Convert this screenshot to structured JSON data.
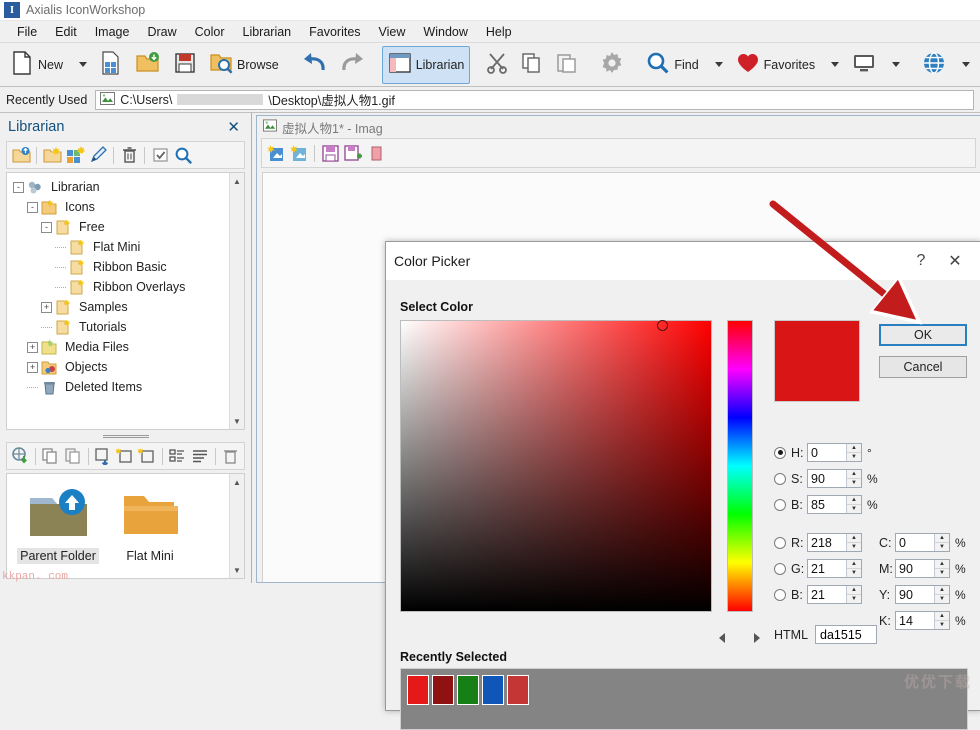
{
  "window": {
    "app_icon_glyph": "I",
    "title": "Axialis IconWorkshop"
  },
  "menubar": {
    "items": [
      "File",
      "Edit",
      "Image",
      "Draw",
      "Color",
      "Librarian",
      "Favorites",
      "View",
      "Window",
      "Help"
    ]
  },
  "toolbar": {
    "new_label": "New",
    "browse_label": "Browse",
    "librarian_label": "Librarian",
    "find_label": "Find",
    "favorites_label": "Favorites",
    "icons": {
      "new": "new-document-icon",
      "new_from_image": "new-from-image-icon",
      "open": "open-folder-icon",
      "save": "save-floppy-icon",
      "browse": "browse-folder-search-icon",
      "undo": "undo-arrow-icon",
      "redo": "redo-arrow-icon",
      "librarian": "librarian-window-icon",
      "cut": "scissors-icon",
      "copy": "copy-icon",
      "paste": "paste-icon",
      "settings": "gear-icon",
      "find": "magnifier-icon",
      "favorites": "heart-icon",
      "display": "monitor-icon",
      "web": "globe-icon",
      "help": "question-help-icon",
      "web2": "globe-green-icon"
    }
  },
  "recently_used": {
    "label": "Recently Used",
    "path_prefix": "C:\\Users\\",
    "path_suffix": "\\Desktop\\虚拟人物1.gif",
    "file_icon": "image-file-icon"
  },
  "librarian_panel": {
    "title": "Librarian",
    "close_icon": "close-icon",
    "toolbar_icons": [
      "new-library-folder-icon",
      "open-library-folder-icon",
      "new-library-icon",
      "rename-pencil-icon",
      "delete-trash-icon",
      "select-checkbox-icon",
      "search-magnifier-icon"
    ],
    "tree": [
      {
        "label": "Librarian",
        "depth": 0,
        "expander": "-",
        "icon": "librarian-root-icon"
      },
      {
        "label": "Icons",
        "depth": 1,
        "expander": "-",
        "icon": "folder-icons-icon"
      },
      {
        "label": "Free",
        "depth": 2,
        "expander": "-",
        "icon": "folder-page-icon"
      },
      {
        "label": "Flat Mini",
        "depth": 3,
        "expander": "",
        "icon": "folder-page-icon"
      },
      {
        "label": "Ribbon Basic",
        "depth": 3,
        "expander": "",
        "icon": "folder-page-icon"
      },
      {
        "label": "Ribbon Overlays",
        "depth": 3,
        "expander": "",
        "icon": "folder-page-icon"
      },
      {
        "label": "Samples",
        "depth": 2,
        "expander": "+",
        "icon": "folder-page-icon"
      },
      {
        "label": "Tutorials",
        "depth": 2,
        "expander": "",
        "icon": "folder-page-icon"
      },
      {
        "label": "Media Files",
        "depth": 1,
        "expander": "+",
        "icon": "folder-media-icon"
      },
      {
        "label": "Objects",
        "depth": 1,
        "expander": "+",
        "icon": "folder-objects-icon"
      },
      {
        "label": "Deleted Items",
        "depth": 1,
        "expander": "",
        "icon": "recycle-bin-icon"
      }
    ],
    "browse_toolbar_icons": [
      "globe-download-icon",
      "copy-icon",
      "paste-icon",
      "import-image-icon",
      "new-item-icon",
      "new-item-alt-icon",
      "sort-icon",
      "list-view-icon",
      "delete-trash-icon"
    ],
    "folders": [
      {
        "label": "Parent Folder",
        "icon": "parent-folder-up-icon",
        "selected": true
      },
      {
        "label": "Flat Mini",
        "icon": "folder-open-icon",
        "selected": false
      }
    ],
    "footer_watermark": "kkpan. com"
  },
  "document_window": {
    "title": "虚拟人物1* - Imag",
    "title_icon": "image-file-icon",
    "toolbar_icons": [
      "new-layer-icon",
      "new-layer-alt-icon",
      "save-icon",
      "save-as-icon",
      "delete-icon"
    ]
  },
  "color_picker": {
    "title": "Color Picker",
    "help_glyph": "?",
    "close_glyph": "✕",
    "select_color_label": "Select Color",
    "recently_selected_label": "Recently Selected",
    "ok_label": "OK",
    "cancel_label": "Cancel",
    "preview_color": "#da1515",
    "sv_cursor": {
      "x_pct": 87,
      "y_pct": 0
    },
    "fields": {
      "h": {
        "label": "H:",
        "value": "0",
        "unit": "°",
        "selected": true
      },
      "s": {
        "label": "S:",
        "value": "90",
        "unit": "%",
        "selected": false
      },
      "b": {
        "label": "B:",
        "value": "85",
        "unit": "%",
        "selected": false
      },
      "r": {
        "label": "R:",
        "value": "218",
        "unit": "",
        "selected": false
      },
      "g": {
        "label": "G:",
        "value": "21",
        "unit": "",
        "selected": false
      },
      "b2": {
        "label": "B:",
        "value": "21",
        "unit": "",
        "selected": false
      },
      "c": {
        "label": "C:",
        "value": "0",
        "unit": "%"
      },
      "m": {
        "label": "M:",
        "value": "90",
        "unit": "%"
      },
      "y": {
        "label": "Y:",
        "value": "90",
        "unit": "%"
      },
      "k": {
        "label": "K:",
        "value": "14",
        "unit": "%"
      }
    },
    "html_label": "HTML",
    "html_value": "da1515",
    "recently_selected_swatches": [
      "#e61919",
      "#8f1111",
      "#168016",
      "#1055b8",
      "#c43636"
    ],
    "panel_background": "#848484"
  },
  "annotation": {
    "arrow_color": "#c31c1c",
    "points_to": "ok-button"
  },
  "watermark_text": "优优下载"
}
